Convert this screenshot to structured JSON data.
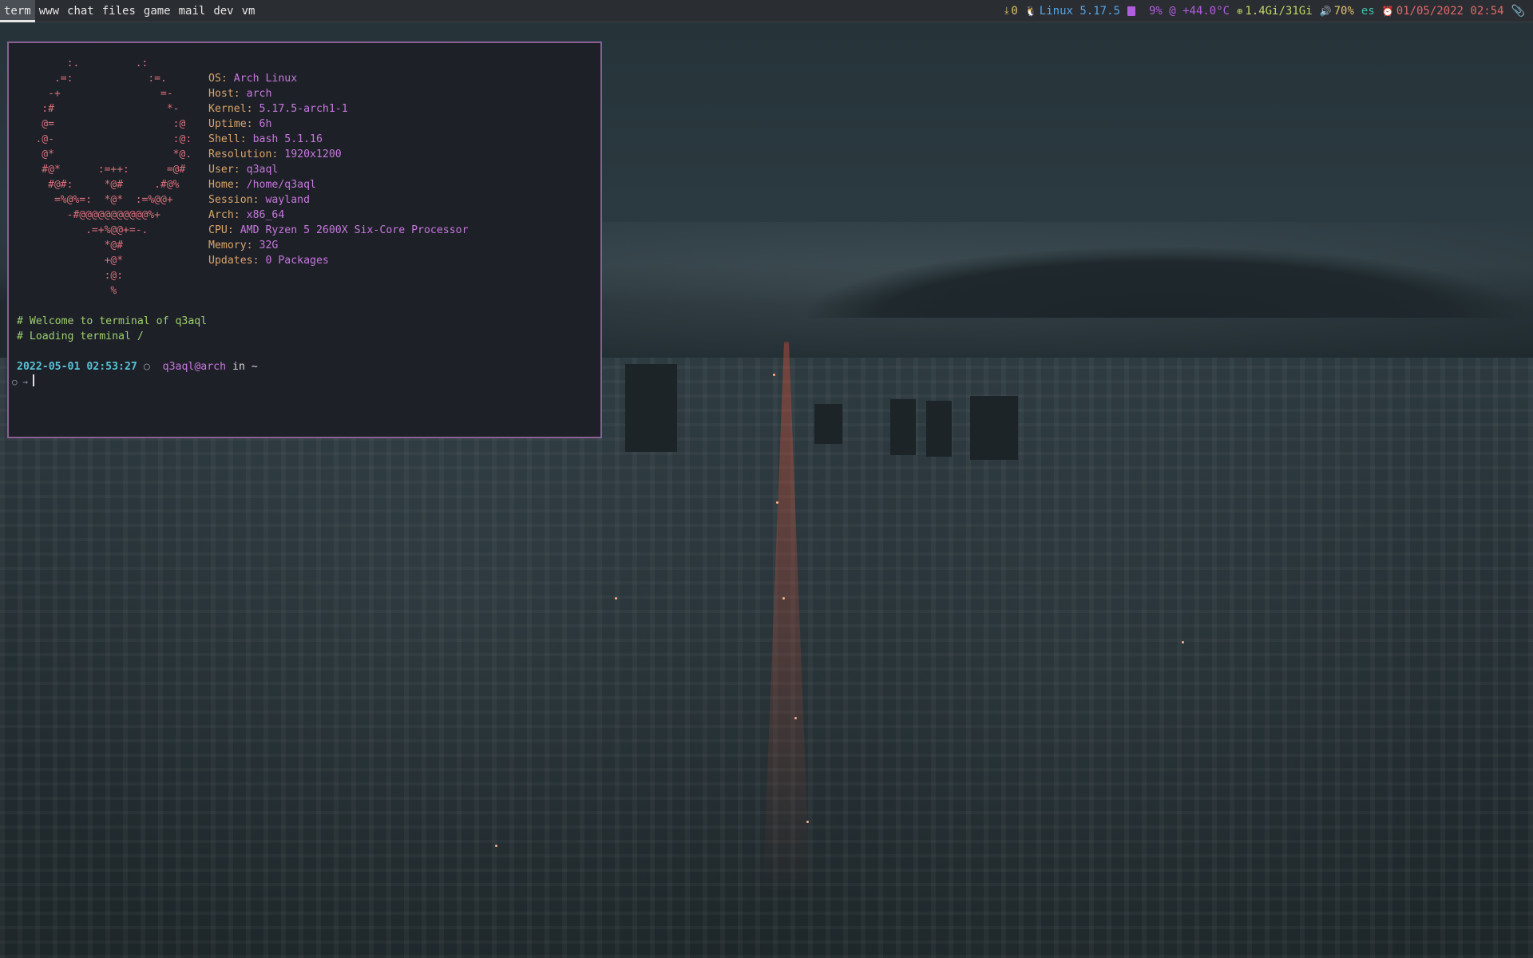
{
  "workspaces": [
    {
      "label": "term",
      "active": true
    },
    {
      "label": "www",
      "active": false
    },
    {
      "label": "chat",
      "active": false
    },
    {
      "label": "files",
      "active": false
    },
    {
      "label": "game",
      "active": false
    },
    {
      "label": "mail",
      "active": false
    },
    {
      "label": "dev",
      "active": false
    },
    {
      "label": "vm",
      "active": false
    }
  ],
  "status": {
    "updates": {
      "icon": "download-icon",
      "text": "0",
      "color": "#e0c070"
    },
    "kernel": {
      "icon": "linux-icon",
      "text": "Linux 5.17.5",
      "color": "#56a6e6"
    },
    "cpu": {
      "icon": "cpu-icon",
      "text": "9% @ +44.0°C",
      "color": "#b05ee0"
    },
    "memory": {
      "icon": "memory-icon",
      "text": "1.4Gi/31Gi",
      "color": "#c2d56a"
    },
    "volume": {
      "icon": "volume-icon",
      "text": "70%",
      "color": "#e0c070"
    },
    "keyboard": {
      "text": "es",
      "color": "#3fc1b0"
    },
    "datetime": {
      "icon": "calendar-icon",
      "text": "01/05/2022 02:54",
      "color": "#e06a6a"
    },
    "tray": {
      "icon": "paperclip-icon",
      "color": "#d0d0d0"
    }
  },
  "terminal": {
    "logo_lines": [
      "        :.         .:",
      "      .=:            :=.",
      "     -+                =-",
      "    :#                  *-",
      "    @=                   :@",
      "   .@-                   :@:",
      "    @*                   *@.",
      "    #@*      :=++:      =@#",
      "     #@#:     *@#     .#@%",
      "      =%@%=:  *@*  :=%@@+",
      "        -#@@@@@@@@@@@%+",
      "           .=+%@@+=-.",
      "              *@#",
      "              +@*",
      "              :@:",
      "               %"
    ],
    "info": [
      {
        "key": "OS: ",
        "value": "Arch Linux"
      },
      {
        "key": "Host: ",
        "value": "arch"
      },
      {
        "key": "Kernel: ",
        "value": "5.17.5-arch1-1"
      },
      {
        "key": "Uptime: ",
        "value": "6h"
      },
      {
        "key": "Shell: ",
        "value": "bash 5.1.16"
      },
      {
        "key": "Resolution: ",
        "value": "1920x1200"
      },
      {
        "key": "User: ",
        "value": "q3aql"
      },
      {
        "key": "Home: ",
        "value": "/home/q3aql"
      },
      {
        "key": "Session: ",
        "value": "wayland"
      },
      {
        "key": "Arch: ",
        "value": "x86_64"
      },
      {
        "key": "CPU: ",
        "value": "AMD Ryzen 5 2600X Six-Core Processor"
      },
      {
        "key": "Memory: ",
        "value": "32G"
      },
      {
        "key": "Updates: ",
        "value": "0 Packages"
      }
    ],
    "comments": [
      "# Welcome to terminal of q3aql",
      "# Loading terminal /"
    ],
    "prompt": {
      "time": "2022-05-01 02:53:27",
      "dot": "○",
      "user_host": "q3aql@arch",
      "in": "in",
      "dir": "~",
      "lead": "○ →"
    }
  }
}
